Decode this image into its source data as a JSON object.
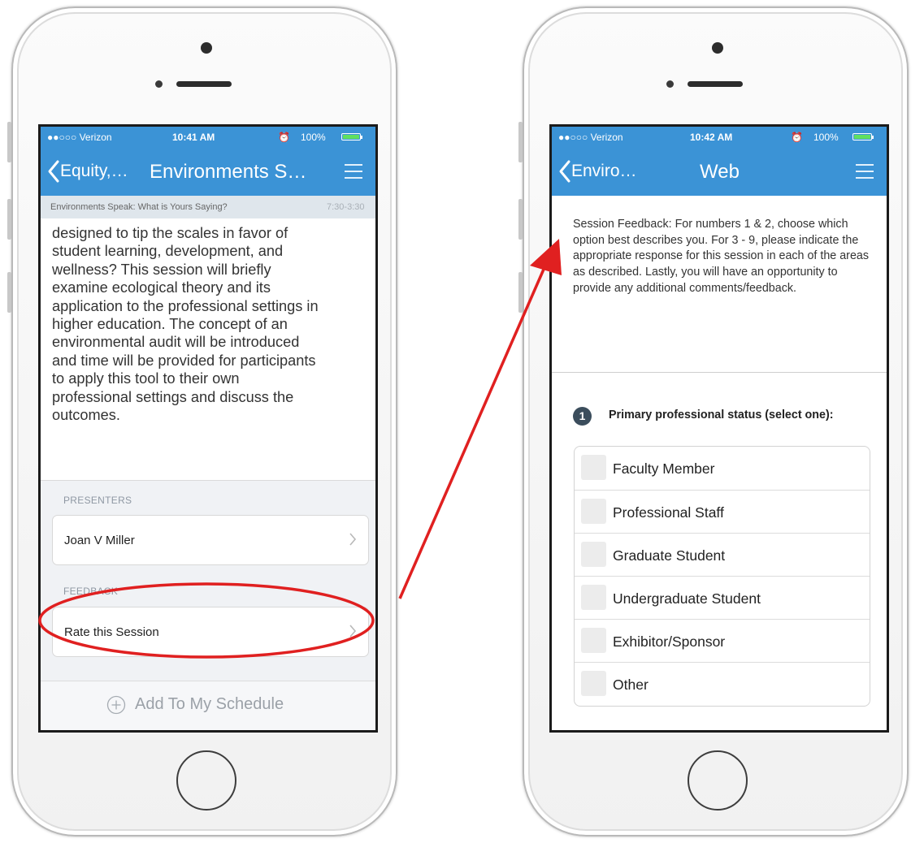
{
  "left_phone": {
    "status_bar": {
      "carrier": "●●○○○ Verizon",
      "time": "10:41 AM",
      "battery": "100%"
    },
    "nav": {
      "back_label": "Equity,…",
      "title": "Environments S…",
      "menu_icon": "hamburger-menu-icon"
    },
    "session_header": {
      "title": "Environments Speak: What is Yours Saying?",
      "time": "7:30-3:30"
    },
    "description": "designed to tip the scales in favor of\nstudent learning, development, and\nwellness?  This session will briefly\nexamine ecological theory and its\napplication to the professional settings in\nhigher education.  The concept of an\nenvironmental audit will be introduced\nand time will be provided for participants\nto apply this tool to their own\nprofessional settings and discuss the\noutcomes.",
    "presenters": {
      "label": "PRESENTERS",
      "name": "Joan V Miller"
    },
    "feedback": {
      "label": "FEEDBACK",
      "action": "Rate this Session"
    },
    "add_to_schedule": "Add To My Schedule"
  },
  "right_phone": {
    "status_bar": {
      "carrier": "●●○○○ Verizon",
      "time": "10:42 AM",
      "battery": "100%"
    },
    "nav": {
      "back_label": "Enviro…",
      "title": "Web",
      "menu_icon": "hamburger-menu-icon"
    },
    "intro": "Session Feedback: For numbers 1 & 2, choose which option best describes you. For 3 - 9, please indicate the appropriate response for this session in each of the areas as described. Lastly, you will have an opportunity to provide any additional comments/feedback.",
    "question": {
      "number": "1",
      "text": "Primary professional status (select one):",
      "options": [
        "Faculty Member",
        "Professional Staff",
        "Graduate Student",
        "Undergraduate Student",
        "Exhibitor/Sponsor",
        "Other"
      ]
    }
  },
  "colors": {
    "nav_blue": "#3b93d6",
    "annotation_red": "#e02020",
    "battery_green": "#5fe05f"
  }
}
